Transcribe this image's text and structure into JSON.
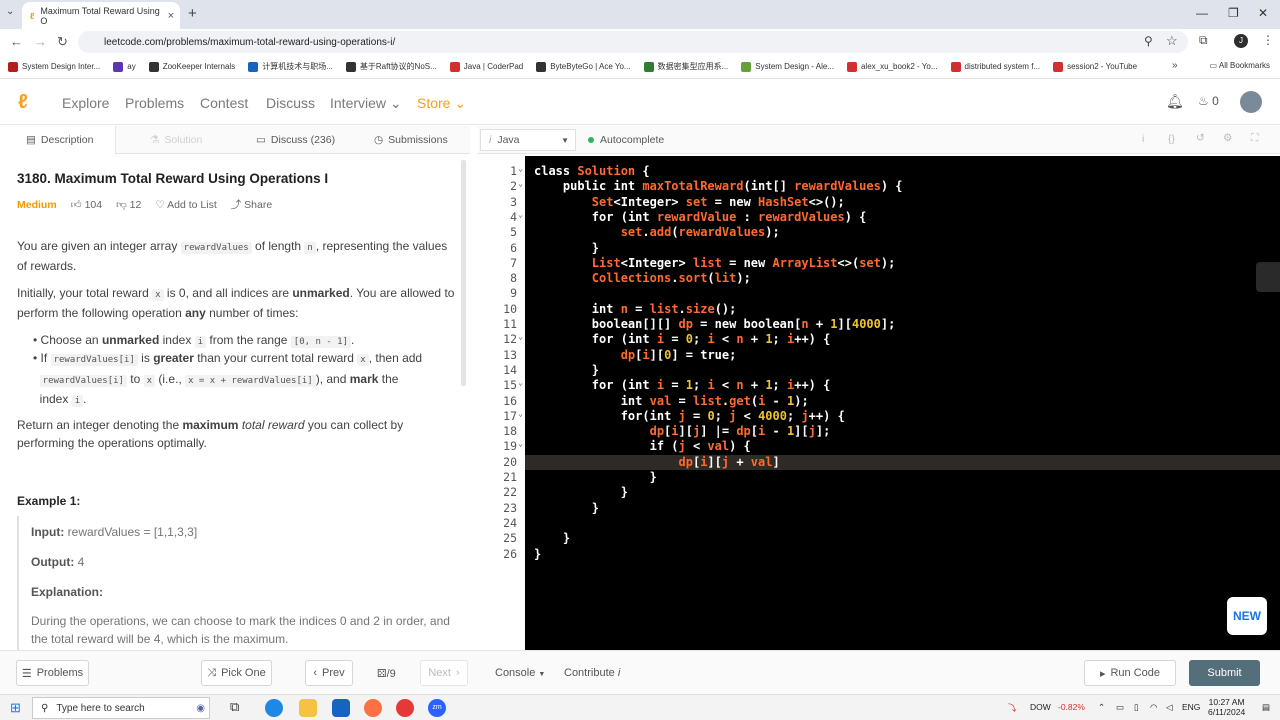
{
  "browser": {
    "tab_title": "Maximum Total Reward Using O",
    "url": "leetcode.com/problems/maximum-total-reward-using-operations-i/",
    "bookmarks": [
      {
        "label": "System Design Inter...",
        "color": "#b71c1c"
      },
      {
        "label": "ay",
        "color": "#5e35b1"
      },
      {
        "label": "ZooKeeper Internals",
        "color": "#333333"
      },
      {
        "label": "计算机技术与职场...",
        "color": "#1565c0"
      },
      {
        "label": "基于Raft协议的NoS...",
        "color": "#333333"
      },
      {
        "label": "Java | CoderPad",
        "color": "#d32f2f"
      },
      {
        "label": "ByteByteGo | Ace Yo...",
        "color": "#333333"
      },
      {
        "label": "数据密集型应用系...",
        "color": "#2e7d32"
      },
      {
        "label": "System Design - Ale...",
        "color": "#689f38"
      },
      {
        "label": "alex_xu_book2 - Yo...",
        "color": "#d32f2f"
      },
      {
        "label": "distributed system f...",
        "color": "#d32f2f"
      },
      {
        "label": "session2 - YouTube",
        "color": "#d32f2f"
      }
    ],
    "all_bookmarks": "All Bookmarks"
  },
  "nav": {
    "explore": "Explore",
    "problems": "Problems",
    "contest": "Contest",
    "discuss": "Discuss",
    "interview": "Interview",
    "store": "Store",
    "fires": "0"
  },
  "left_tabs": {
    "description": "Description",
    "solution": "Solution",
    "discuss": "Discuss (236)",
    "submissions": "Submissions"
  },
  "problem": {
    "title": "3180. Maximum Total Reward Using Operations I",
    "difficulty": "Medium",
    "likes": "104",
    "dislikes": "12",
    "add_to_list": "Add to List",
    "share": "Share",
    "p1a": "You are given an integer array ",
    "p1code": "rewardValues",
    "p1b": " of length ",
    "p1n": "n",
    "p1c": ", representing the values",
    "p1d": "of rewards.",
    "p2a": "Initially, your total reward ",
    "p2x": "x",
    "p2b": " is 0, and all indices are ",
    "p2un": "unmarked",
    "p2c": ". You are allowed to",
    "p2d": "perform the following operation ",
    "p2any": "any",
    "p2e": " number of times:",
    "b1a": "Choose an ",
    "b1un": "unmarked",
    "b1b": " index ",
    "b1i": "i",
    "b1c": " from the range ",
    "b1r": "[0, n - 1]",
    "b2a": "If ",
    "b2code": "rewardValues[i]",
    "b2b": " is ",
    "b2g": "greater",
    "b2c": " than your current total reward ",
    "b2x": "x",
    "b2d": ", then add",
    "b2e": "rewardValues[i]",
    "b2f": " to ",
    "b2fx": "x",
    "b2h": " (i.e., ",
    "b2eq": "x = x + rewardValues[i]",
    "b2j": "), and ",
    "b2mark": "mark",
    "b2k": " the",
    "b2l": "index ",
    "b2i": "i",
    "p3a": "Return an integer denoting the ",
    "p3max": "maximum",
    "p3it": " total reward",
    "p3b": " you can collect by",
    "p3c": "performing the operations optimally.",
    "ex1": "Example 1:",
    "input_label": "Input:",
    "input_val": " rewardValues = [1,1,3,3]",
    "output_label": "Output:",
    "output_val": " 4",
    "explanation": "Explanation:",
    "exp1": "During the operations, we can choose to mark the indices 0 and 2 in order, and",
    "exp2": "the total reward will be 4, which is the maximum."
  },
  "editor": {
    "language": "Java",
    "autocomplete": "Autocomplete",
    "lines": [
      "1",
      "2",
      "3",
      "4",
      "5",
      "6",
      "7",
      "8",
      "9",
      "10",
      "11",
      "12",
      "13",
      "14",
      "15",
      "16",
      "17",
      "18",
      "19",
      "20",
      "21",
      "22",
      "23",
      "24",
      "25",
      "26"
    ]
  },
  "bottom": {
    "problems": "Problems",
    "pick_one": "Pick One",
    "prev": "Prev",
    "page": "/9",
    "next": "Next",
    "console": "Console",
    "contribute": "Contribute",
    "run": "Run Code",
    "submit": "Submit",
    "new": "NEW"
  },
  "taskbar": {
    "search": "Type here to search",
    "dow": "DOW",
    "dow_change": "-0.82%",
    "lang": "ENG",
    "time": "10:27 AM",
    "date": "6/11/2024"
  }
}
